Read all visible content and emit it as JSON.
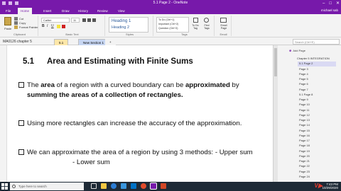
{
  "window": {
    "title": "5.1 Page 2 - OneNote",
    "user": "michael sab"
  },
  "ribbon_tabs": [
    "File",
    "Home",
    "Insert",
    "Draw",
    "History",
    "Review",
    "View"
  ],
  "ribbon": {
    "clipboard": {
      "paste_label": "Paste",
      "cut_label": "Cut",
      "copy_label": "Copy",
      "format_painter_label": "Format Painter",
      "group_label": "Clipboard"
    },
    "basic_text": {
      "font_name": "Calibri",
      "font_size": "11",
      "group_label": "Basic Text"
    },
    "styles": {
      "heading1": "Heading 1",
      "heading2": "Heading 2",
      "group_label": "Styles"
    },
    "tags": {
      "items": [
        "To Do (Ctrl+1)",
        "Important (Ctrl+2)",
        "Question (Ctrl+3)"
      ],
      "todo_tag_label": "To Do Tag",
      "find_tags_label": "Find Tags",
      "group_label": "Tags"
    },
    "email": {
      "label": "Email Page",
      "group_label": "Email"
    }
  },
  "section_bar": {
    "notebook": "MA0126 chapter 5",
    "tabs": [
      "5.1",
      "New Section 1"
    ],
    "add_tab": "+",
    "search_placeholder": "Search (Ctrl+E)"
  },
  "page": {
    "section_number": "5.1",
    "title": "Area and Estimating with Finite Sums",
    "bullets": [
      [
        "The ",
        {
          "b": "area"
        },
        " of a region with a curved boundary can be ",
        {
          "b": "approximated"
        },
        " by ",
        {
          "b": "summing the areas of a collection of rectangles."
        }
      ],
      [
        "Using more rectangles can increase the accuracy of the approximation."
      ],
      [
        "We can approximate the area of a region by using 3 methods: - Upper sum"
      ]
    ],
    "methods_cont": [
      "- Lower sum"
    ]
  },
  "pages_pane": {
    "add_page": "Add Page",
    "pages": [
      "Chapter 5 INTEGRATION",
      "5.1 Page 2",
      "Page 3",
      "Page 4",
      "Page 5",
      "Page 6",
      "Page 7",
      "5.1 Page 8",
      "Page 9",
      "Page 10",
      "Page 11",
      "Page 12",
      "Page 13",
      "Page 14",
      "Page 15",
      "Page 16",
      "Page 17",
      "Page 18",
      "Page 19",
      "Page 20",
      "Page 21",
      "Page 22",
      "Page 23",
      "Page 24"
    ],
    "selected_index": 1
  },
  "taskbar": {
    "search_placeholder": "Type here to search",
    "time": "7:43 PM",
    "date": "10/29/2020"
  },
  "colors": {
    "accent": "#7719aa",
    "ribbon_bg": "#f3f3f3",
    "taskbar_bg": "#1e2a36",
    "selected_page": "#d9d9f3"
  }
}
